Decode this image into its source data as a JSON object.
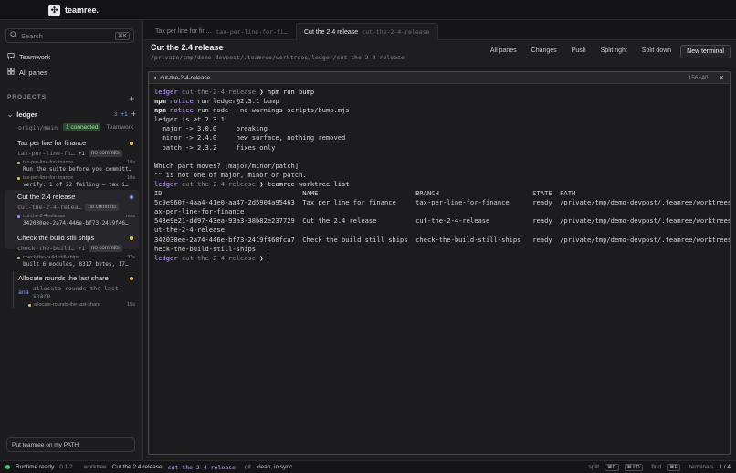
{
  "app": {
    "name": "teamree."
  },
  "sidebar": {
    "search_placeholder": "Search",
    "search_shortcut": "⌘K",
    "nav": [
      {
        "label": "Teamwork",
        "icon": "chat-icon"
      },
      {
        "label": "All panes",
        "icon": "grid-icon"
      }
    ],
    "projects_label": "PROJECTS",
    "repo": {
      "name": "ledger",
      "count": "3",
      "plus": "+1",
      "origin": "origin/main",
      "connected": "1 connected",
      "teamwork": "Teamwork"
    },
    "worktrees": [
      {
        "title": "Tax per line for finance",
        "branch": "tax-per-line-fo…",
        "ahead": "+1",
        "badge": "no commits",
        "subs": [
          {
            "name": "tax-per-line-for-finance",
            "time": "10s",
            "text": "Run the suite before you committ…"
          },
          {
            "name": "tax-per-line-for-finance",
            "time": "10s",
            "text": "verify: 1 of 22 failing — tax i…"
          }
        ]
      },
      {
        "title": "Cut the 2.4 release",
        "branch": "cut-the-2-4-relea…",
        "badge": "no commits",
        "subs": [
          {
            "name": "cut-the-2-4-release",
            "time": "now",
            "text": "342030ee-2a74-446e-bf73-2419f46…"
          }
        ]
      },
      {
        "title": "Check the build still ships",
        "branch": "check-the-build…",
        "ahead": "+1",
        "badge": "no commits",
        "subs": [
          {
            "name": "check-the-build-still-ships",
            "time": "37s",
            "text": "built 6 modules, 8317 bytes, 17…"
          }
        ]
      },
      {
        "title": "Allocate rounds the last share",
        "branch": "allocate-rounds-the-last-share",
        "prefix": "ana",
        "subs": [
          {
            "name": "allocate-rounds-the-last-share",
            "time": "15s",
            "text": ""
          }
        ]
      }
    ],
    "path_button": "Put teamree on my PATH"
  },
  "tabs": [
    {
      "title": "Tax per line for fin…",
      "branch": "tax-per-line-for-fi…"
    },
    {
      "title": "Cut the 2.4 release",
      "branch": "cut-the-2-4-release"
    }
  ],
  "header": {
    "title": "Cut the 2.4 release",
    "path": "/private/tmp/demo-devpost/.teamree/worktrees/ledger/cut-the-2-4-release",
    "actions": [
      "All panes",
      "Changes",
      "Push",
      "Split right",
      "Split down",
      "New terminal"
    ]
  },
  "terminal": {
    "title": "cut-the-2-4-release",
    "size": "156×40",
    "prompt_repo": "ledger",
    "prompt_branch": "cut-the-2-4-release",
    "prompt_sym": "❯",
    "cmd1": "npm run bump",
    "npm_lines": [
      {
        "head": "npm",
        "kw": "notice",
        "rest": " run ledger@2.3.1 bump"
      },
      {
        "head": "npm",
        "kw": "notice",
        "rest": " run node --no-warnings scripts/bump.mjs"
      }
    ],
    "out1": [
      "ledger is at 2.3.1",
      "  major -> 3.0.0     breaking",
      "  minor -> 2.4.0     new surface, nothing removed",
      "  patch -> 2.3.2     fixes only",
      "",
      "Which part moves? [major/minor/patch]",
      "\"\" is not one of major, minor or patch."
    ],
    "cmd2": "teamree worktree list",
    "table_lines": [
      "ID                                    NAME                         BRANCH                        STATE  PATH",
      "5c9e960f-4aa4-41e0-aa47-2d5904a95463  Tax per line for finance     tax-per-line-for-finance      ready  /private/tmp/demo-devpost/.teamree/worktrees/ledger/t",
      "ax-per-line-for-finance",
      "543e9e21-dd97-43ea-93a3-38b82e237729  Cut the 2.4 release          cut-the-2-4-release           ready  /private/tmp/demo-devpost/.teamree/worktrees/ledger/c",
      "ut-the-2-4-release",
      "342030ee-2a74-446e-bf73-2419f460fca7  Check the build still ships  check-the-build-still-ships   ready  /private/tmp/demo-devpost/.teamree/worktrees/ledger/c",
      "heck-the-build-still-ships"
    ]
  },
  "status": {
    "runtime": "Runtime ready",
    "version": "0.1.2",
    "worktree_label": "worktree",
    "worktree": "Cut the 2.4 release",
    "branch": "cut-the-2-4-release",
    "git_label": "git",
    "git": "clean, in sync",
    "split_label": "split",
    "split_k1": "⌘D",
    "split_k2": "⌘⇧D",
    "find_label": "find",
    "find_k": "⌘F",
    "terminals_label": "terminals",
    "terminals": "1 / 4"
  },
  "colors": {
    "accent": "#c7a6ff",
    "warn": "#e8c35a",
    "ok": "#4fc36a",
    "info": "#8a9cff"
  }
}
